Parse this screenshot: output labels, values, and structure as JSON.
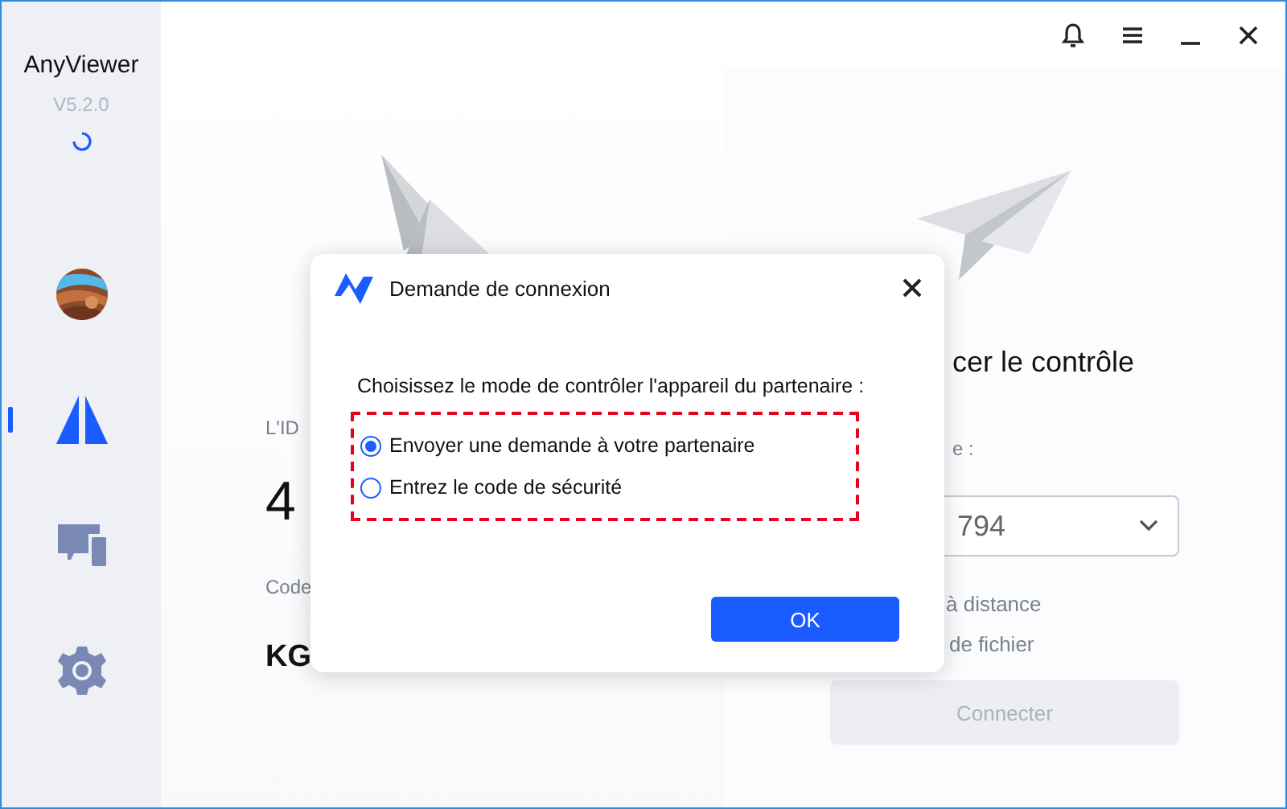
{
  "sidebar": {
    "app_name": "AnyViewer",
    "version": "V5.2.0",
    "nav": [
      {
        "kind": "avatar"
      },
      {
        "kind": "connect",
        "selected": true
      },
      {
        "kind": "devices",
        "selected": false
      },
      {
        "kind": "settings",
        "selected": false
      }
    ]
  },
  "left_panel": {
    "id_label": "L'ID",
    "id_value": "4",
    "code_label": "Code",
    "code_value": "KG"
  },
  "right_panel": {
    "title": "cer le contrôle",
    "field_label": "e :",
    "partner_id": "794",
    "options": [
      "à distance",
      "de fichier"
    ],
    "connect_button": {
      "label": "Connecter",
      "disabled": true
    }
  },
  "dialog": {
    "title": "Demande de connexion",
    "prompt": "Choisissez le mode de contrôler l'appareil du partenaire :",
    "options": [
      {
        "label": "Envoyer une demande à votre partenaire",
        "selected": true
      },
      {
        "label": "Entrez le code de sécurité",
        "selected": false
      }
    ],
    "ok_button": "OK"
  }
}
